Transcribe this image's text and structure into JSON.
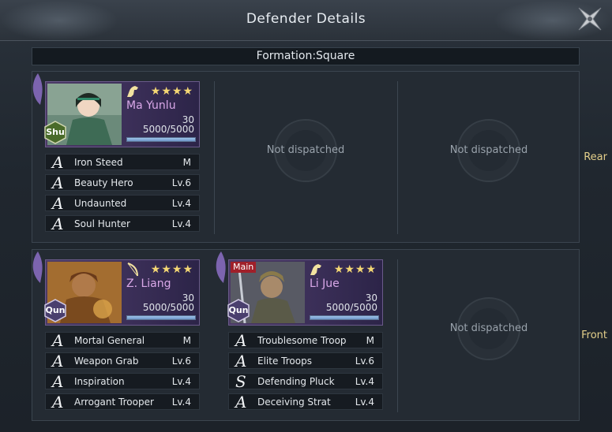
{
  "window": {
    "title": "Defender Details"
  },
  "formation": {
    "label": "Formation:Square"
  },
  "rows": {
    "rear": {
      "label": "Rear",
      "hero": {
        "name": "Ma Yunlu",
        "level": "30",
        "troops": "5000/5000",
        "troop_ratio": 1.0,
        "stars": 4,
        "faction": "Shu",
        "faction_color": "#4a6b2a",
        "troop_type_icon": "horse-icon",
        "skills": [
          {
            "grade": "A",
            "name": "Iron Steed",
            "level": "M"
          },
          {
            "grade": "A",
            "name": "Beauty Hero",
            "level": "Lv.6"
          },
          {
            "grade": "A",
            "name": "Undaunted",
            "level": "Lv.4"
          },
          {
            "grade": "A",
            "name": "Soul Hunter",
            "level": "Lv.4"
          }
        ]
      },
      "slot2": "Not dispatched",
      "slot3": "Not dispatched"
    },
    "front": {
      "label": "Front",
      "hero1": {
        "name": "Z. Liang",
        "level": "30",
        "troops": "5000/5000",
        "troop_ratio": 1.0,
        "stars": 4,
        "faction": "Qun",
        "faction_color": "#4a3f6e",
        "troop_type_icon": "bow-icon",
        "skills": [
          {
            "grade": "A",
            "name": "Mortal General",
            "level": "M"
          },
          {
            "grade": "A",
            "name": "Weapon Grab",
            "level": "Lv.6"
          },
          {
            "grade": "A",
            "name": "Inspiration",
            "level": "Lv.4"
          },
          {
            "grade": "A",
            "name": "Arrogant Trooper",
            "level": "Lv.4"
          }
        ]
      },
      "hero2": {
        "badge": "Main",
        "name": "Li Jue",
        "level": "30",
        "troops": "5000/5000",
        "troop_ratio": 1.0,
        "stars": 4,
        "faction": "Qun",
        "faction_color": "#4a3f6e",
        "troop_type_icon": "horse-icon",
        "skills": [
          {
            "grade": "A",
            "name": "Troublesome Troop",
            "level": "M"
          },
          {
            "grade": "A",
            "name": "Elite Troops",
            "level": "Lv.6"
          },
          {
            "grade": "S",
            "name": "Defending Pluck",
            "level": "Lv.4"
          },
          {
            "grade": "A",
            "name": "Deceiving Strat",
            "level": "Lv.4"
          }
        ]
      },
      "slot3": "Not dispatched"
    }
  },
  "colors": {
    "accent_gold": "#e4cf8a",
    "card_purple": "#3b2f58",
    "star": "#f4d774"
  }
}
